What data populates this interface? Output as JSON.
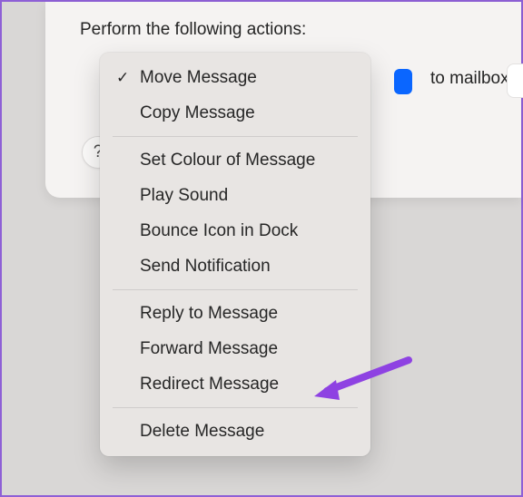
{
  "panel": {
    "heading": "Perform the following actions:",
    "to_label": "to mailbox:",
    "help_glyph": "?"
  },
  "menu": {
    "groups": [
      [
        {
          "label": "Move Message",
          "checked": true
        },
        {
          "label": "Copy Message",
          "checked": false
        }
      ],
      [
        {
          "label": "Set Colour of Message",
          "checked": false
        },
        {
          "label": "Play Sound",
          "checked": false
        },
        {
          "label": "Bounce Icon in Dock",
          "checked": false
        },
        {
          "label": "Send Notification",
          "checked": false
        }
      ],
      [
        {
          "label": "Reply to Message",
          "checked": false
        },
        {
          "label": "Forward Message",
          "checked": false
        },
        {
          "label": "Redirect Message",
          "checked": false
        }
      ],
      [
        {
          "label": "Delete Message",
          "checked": false
        }
      ]
    ]
  }
}
